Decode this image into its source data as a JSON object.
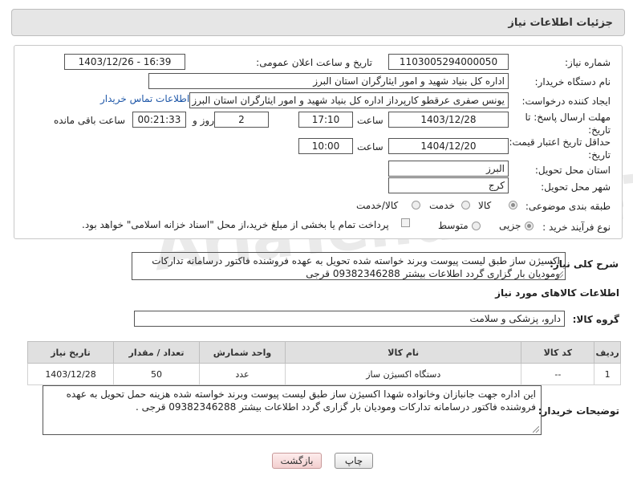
{
  "header": {
    "title": "جزئیات اطلاعات نیاز"
  },
  "form": {
    "need_number_label": "شماره نیاز:",
    "need_number": "1103005294000050",
    "announce_label": "تاریخ و ساعت اعلان عمومی:",
    "announce_value": "1403/12/26 - 16:39",
    "buyer_org_label": "نام دستگاه خریدار:",
    "buyer_org": "اداره کل بنیاد شهید و امور ایثارگران استان البرز",
    "creator_label": "ایجاد کننده درخواست:",
    "creator": "یونس  صفری عرقطو کارپرداز اداره کل بنیاد شهید و امور ایثارگران استان البرز",
    "contact_link": "اطلاعات تماس خریدار",
    "deadline_label": "مهلت ارسال پاسخ: تا تاریخ:",
    "deadline_date": "1403/12/28",
    "time_label": "ساعت",
    "deadline_time": "17:10",
    "days_value": "2",
    "days_label": "روز و",
    "remaining_value": "00:21:33",
    "remaining_label": "ساعت باقی مانده",
    "validity_label": "حداقل تاریخ اعتبار قیمت: تا تاریخ:",
    "validity_date": "1404/12/20",
    "validity_time": "10:00",
    "province_label": "استان محل تحویل:",
    "province": "البرز",
    "city_label": "شهر محل تحویل:",
    "city": "کرج",
    "category_label": "طبقه بندی موضوعی:",
    "category_options": [
      "کالا",
      "خدمت",
      "کالا/خدمت"
    ],
    "process_label": "نوع فرآیند خرید :",
    "process_options": [
      "جزیی",
      "متوسط"
    ],
    "payment_text": "پرداخت تمام یا بخشی از مبلغ خرید،از محل \"اسناد خزانه اسلامی\" خواهد بود."
  },
  "summary": {
    "label": "شرح کلی نیاز:",
    "text": "اکسیژن ساز طبق لیست پیوست وبرند خواسته شده  تحویل به عهده فروشنده فاکتور درسامانه تدارکات وموديان بار گزاری گردد اطلاعات بیشتر 09382346288 قرجی"
  },
  "goods": {
    "section_title": "اطلاعات کالاهای مورد نیاز",
    "group_label": "گروه کالا:",
    "group_value": "دارو، پزشکی و سلامت",
    "columns": [
      "ردیف",
      "کد کالا",
      "نام کالا",
      "واحد شمارش",
      "تعداد / مقدار",
      "تاریخ نیاز"
    ],
    "rows": [
      {
        "row": "1",
        "code": "--",
        "name": "دستگاه اکسیژن ساز",
        "unit": "عدد",
        "qty": "50",
        "date": "1403/12/28"
      }
    ]
  },
  "buyer_notes": {
    "label": "توضیحات خریدار:",
    "text": "این اداره جهت جانبازان وخانواده شهدا اکسیژن ساز طبق  لیست پیوست وبرند خواسته شده هزینه حمل تحویل به عهده فروشنده فاکتور درسامانه تدارکات وموديان بار گزاری گردد اطلاعات بیشتر 09382346288 قرجی ."
  },
  "buttons": {
    "print": "چاپ",
    "back": "بازگشت"
  },
  "watermark": "AriaTender.neT",
  "colors": {
    "link": "#1e57a8",
    "header_bg": "#e6e6e6",
    "back_button": "#f3cfcf"
  }
}
